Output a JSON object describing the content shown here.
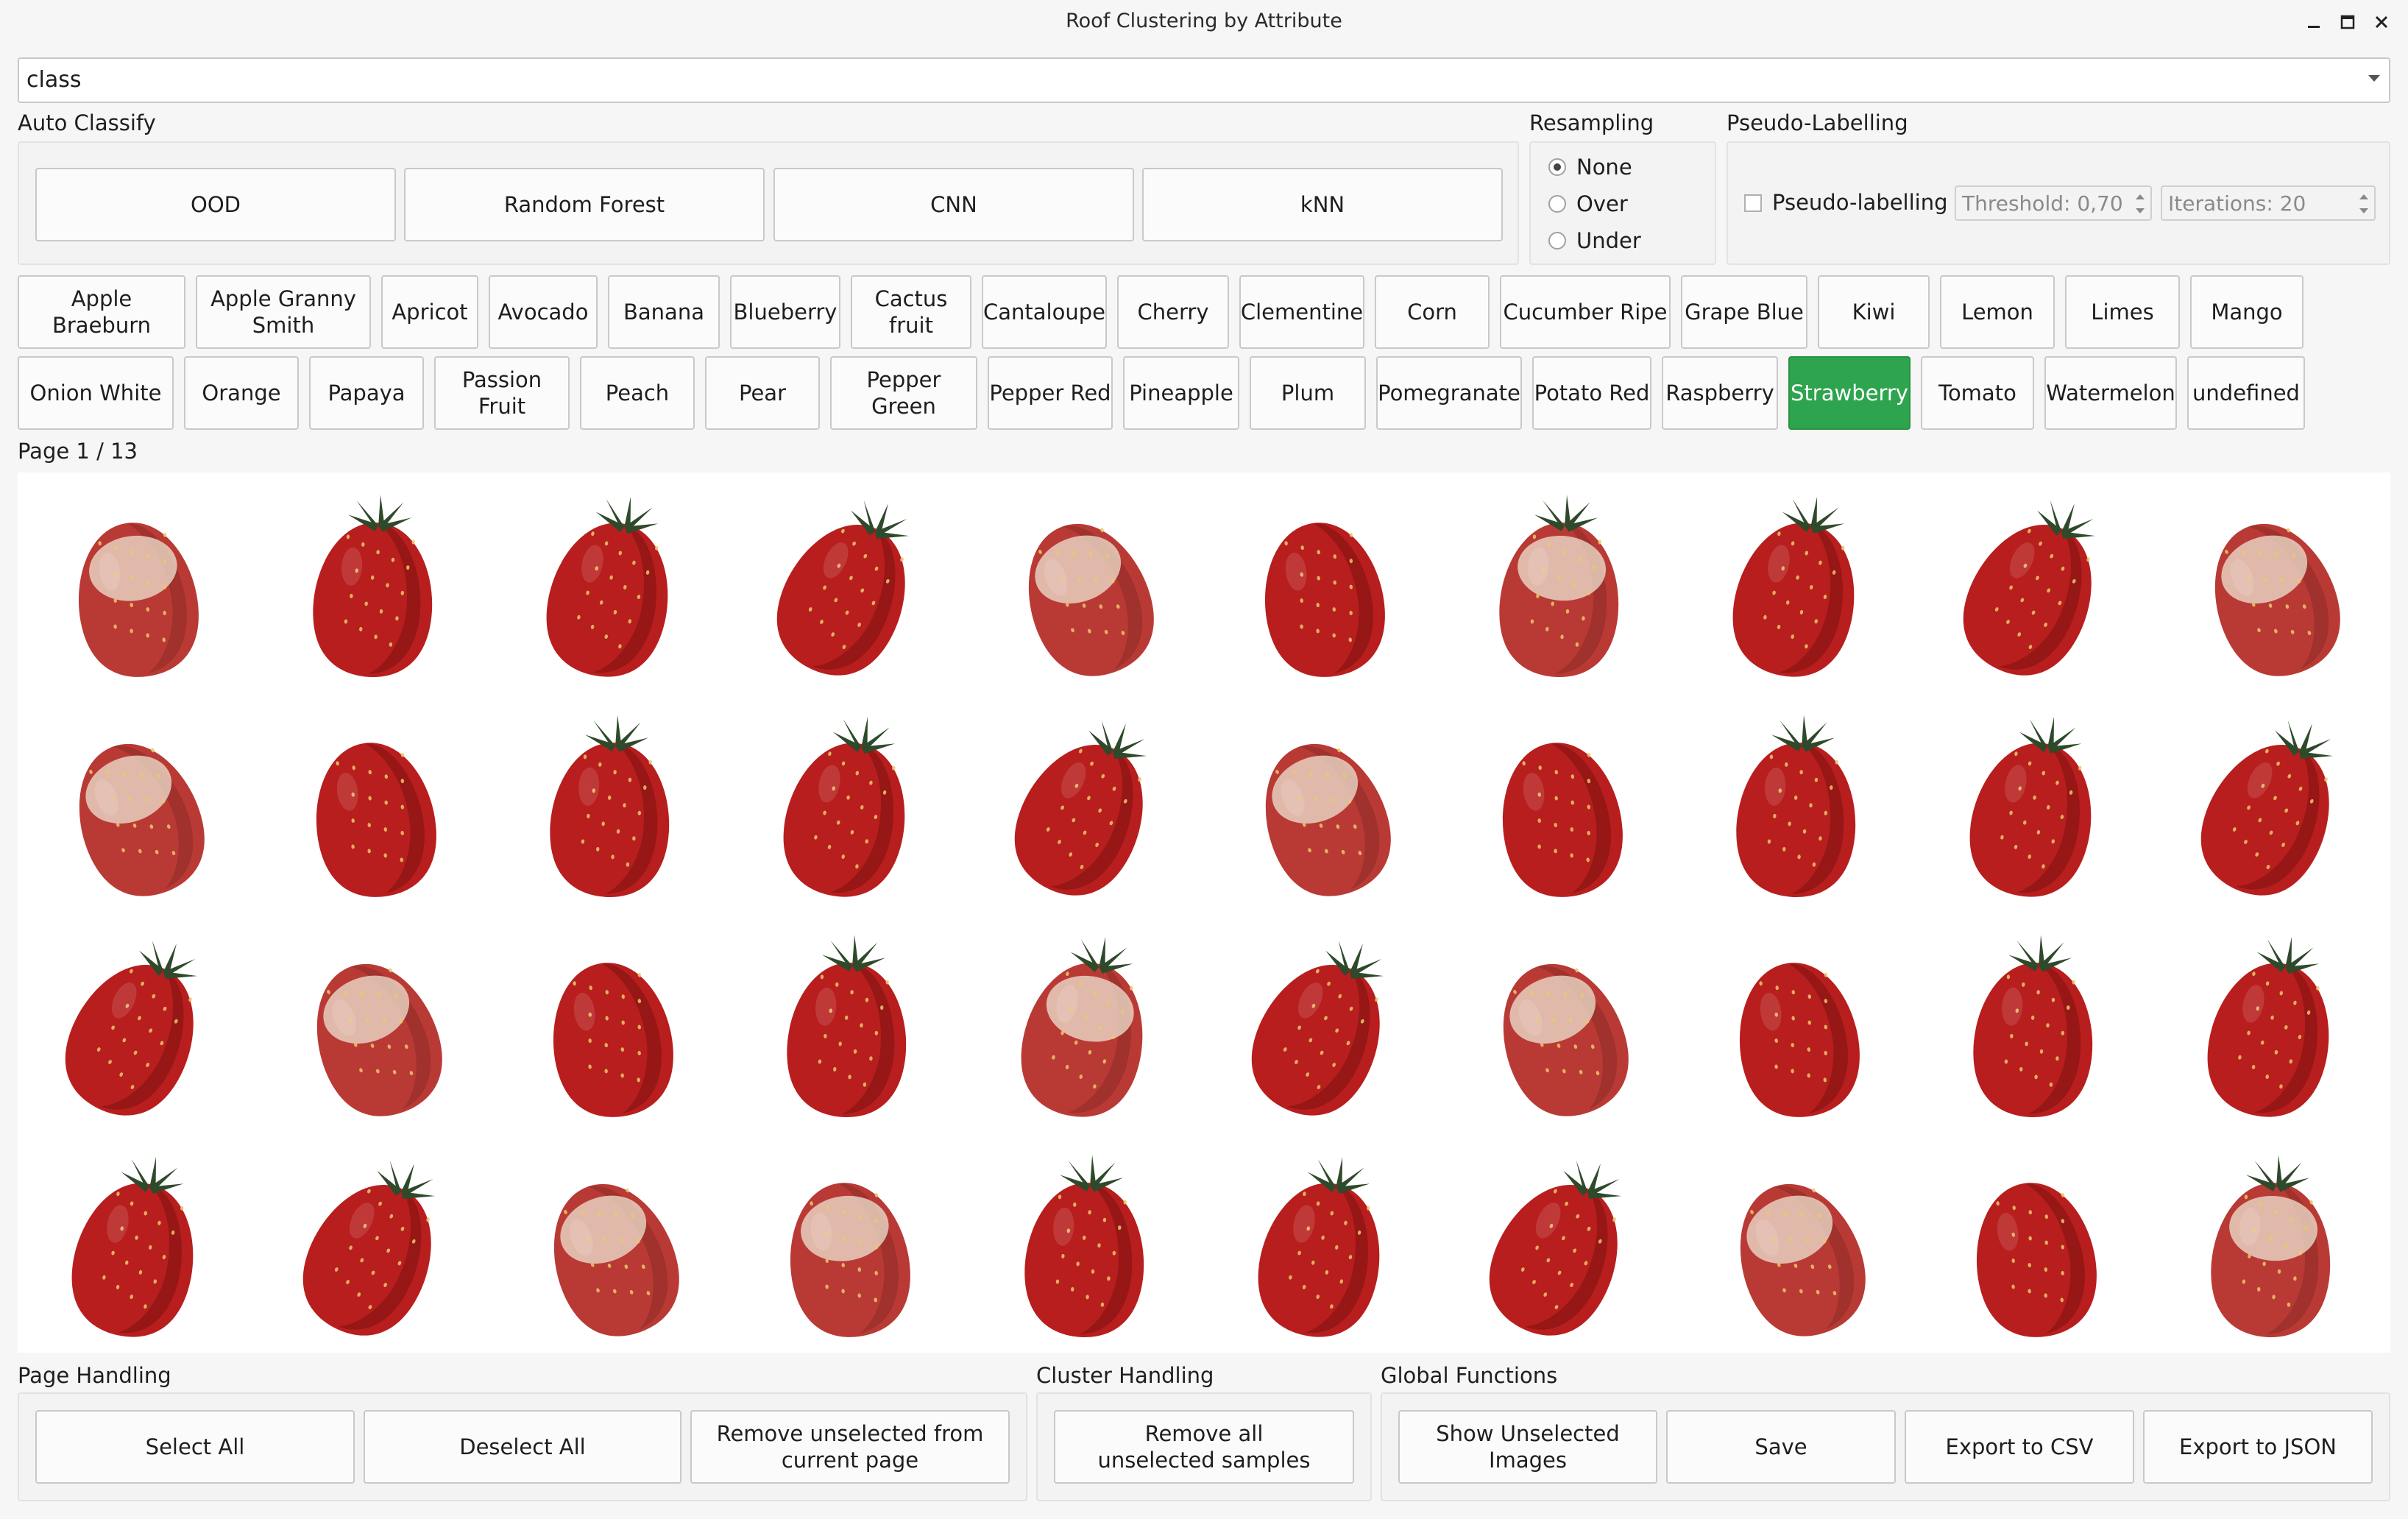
{
  "window": {
    "title": "Roof Clustering by Attribute",
    "controls": [
      "minimize-icon",
      "maximize-icon",
      "close-icon"
    ]
  },
  "attribute_select": {
    "value": "class"
  },
  "auto_classify": {
    "label": "Auto Classify",
    "buttons": [
      "OOD",
      "Random Forest",
      "CNN",
      "kNN"
    ]
  },
  "resampling": {
    "label": "Resampling",
    "options": [
      "None",
      "Over",
      "Under"
    ],
    "selected": "None"
  },
  "pseudo_labelling": {
    "label": "Pseudo-Labelling",
    "checkbox_label": "Pseudo-labelling",
    "checked": false,
    "threshold": "Threshold: 0,70",
    "iterations": "Iterations: 20"
  },
  "classes": {
    "row1": [
      "Apple Braeburn",
      "Apple Granny Smith",
      "Apricot",
      "Avocado",
      "Banana",
      "Blueberry",
      "Cactus fruit",
      "Cantaloupe",
      "Cherry",
      "Clementine",
      "Corn",
      "Cucumber Ripe",
      "Grape Blue",
      "Kiwi",
      "Lemon",
      "Limes",
      "Mango"
    ],
    "row2": [
      "Onion White",
      "Orange",
      "Papaya",
      "Passion Fruit",
      "Peach",
      "Pear",
      "Pepper Green",
      "Pepper Red",
      "Pineapple",
      "Plum",
      "Pomegranate",
      "Potato Red",
      "Raspberry",
      "Strawberry",
      "Tomato",
      "Watermelon",
      "undefined"
    ],
    "selected": "Strawberry",
    "selected_color": "#2ea44f"
  },
  "pagination": {
    "text": "Page 1 / 13"
  },
  "image_grid": {
    "rows": 4,
    "cols": 10,
    "subject": "strawberry"
  },
  "page_handling": {
    "label": "Page Handling",
    "buttons": [
      "Select All",
      "Deselect All",
      "Remove unselected from\ncurrent page"
    ]
  },
  "cluster_handling": {
    "label": "Cluster Handling",
    "buttons": [
      "Remove all\nunselected samples"
    ]
  },
  "global_functions": {
    "label": "Global Functions",
    "buttons": [
      "Show Unselected Images",
      "Save",
      "Export to CSV",
      "Export to JSON"
    ]
  }
}
